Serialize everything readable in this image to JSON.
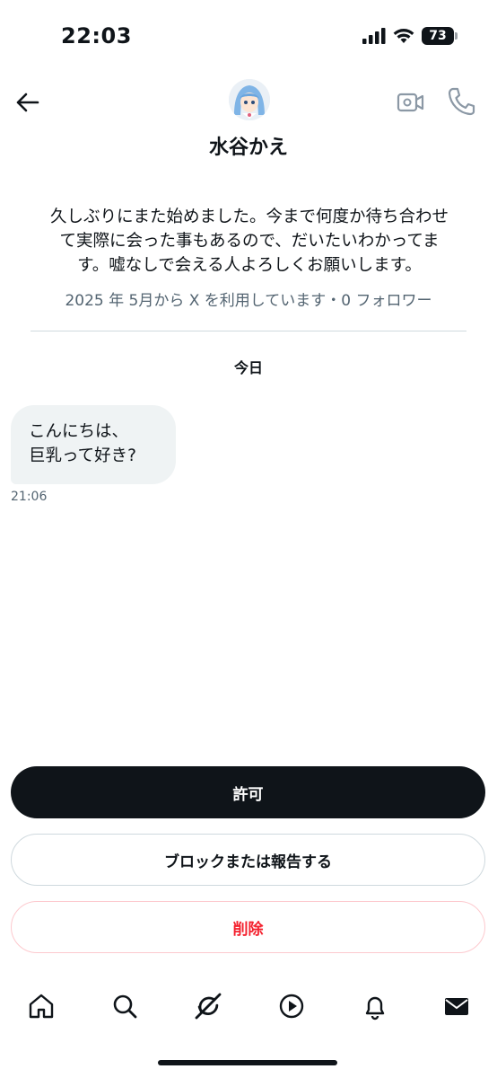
{
  "status_bar": {
    "time": "22:03",
    "battery": "73",
    "icons": [
      "signal-icon",
      "wifi-icon",
      "battery-icon"
    ]
  },
  "header": {
    "back_icon": "arrow-left-icon",
    "video_icon": "video-call-icon",
    "call_icon": "phone-icon",
    "name": "水谷かえ"
  },
  "profile": {
    "bio_lines": [
      "久しぶりにまた始めました。今まで何度か待ち合わせ",
      "て実際に会った事もあるので、だいたいわかってま",
      "す。嘘なしで会える人よろしくお願いします。"
    ],
    "meta": "2025 年 5月から X を利用しています・0 フォロワー"
  },
  "conversation": {
    "date_label": "今日",
    "messages": [
      {
        "lines": [
          "こんにちは、",
          "巨乳って好き?"
        ],
        "time": "21:06"
      }
    ]
  },
  "actions": {
    "allow": "許可",
    "block_report": "ブロックまたは報告する",
    "delete": "削除"
  },
  "bottom_nav": {
    "items": [
      "home-icon",
      "search-icon",
      "grok-icon",
      "video-play-icon",
      "notifications-icon",
      "messages-icon"
    ],
    "active": "messages-icon"
  },
  "colors": {
    "text": "#0f1419",
    "secondary": "#536471",
    "bubble": "#eff3f4",
    "danger": "#f4212e",
    "border": "#cfd9de"
  }
}
